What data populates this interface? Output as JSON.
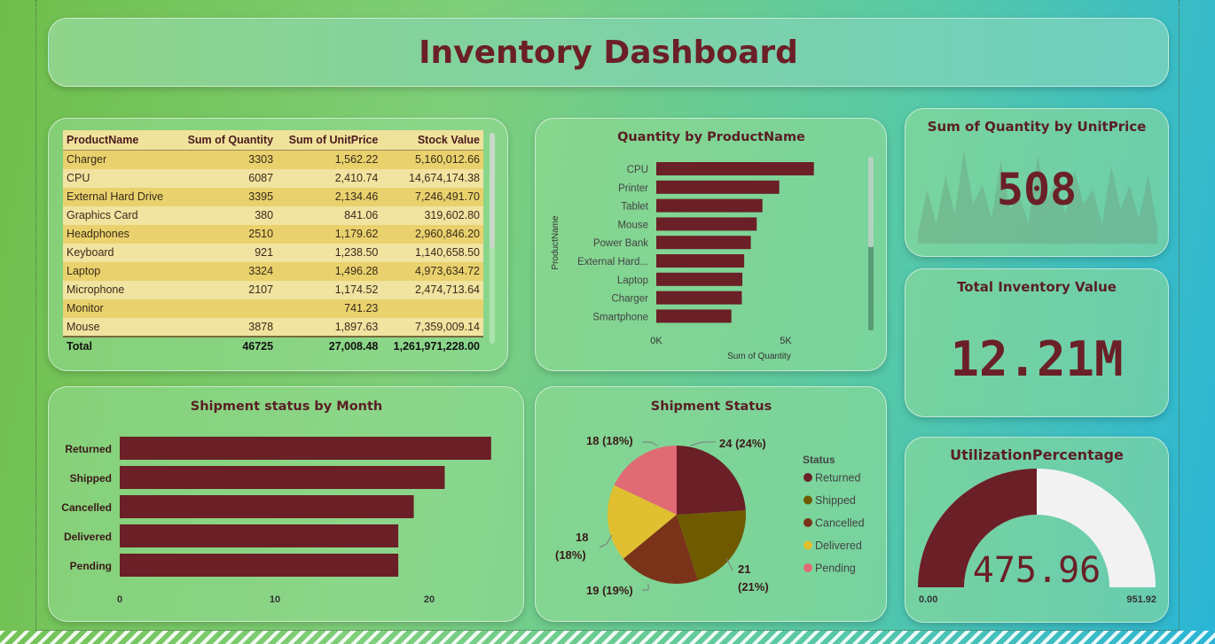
{
  "title": "Inventory Dashboard",
  "table": {
    "headers": [
      "ProductName",
      "Sum of Quantity",
      "Sum of UnitPrice",
      "Stock Value"
    ],
    "rows": [
      [
        "Charger",
        "3303",
        "1,562.22",
        "5,160,012.66"
      ],
      [
        "CPU",
        "6087",
        "2,410.74",
        "14,674,174.38"
      ],
      [
        "External Hard Drive",
        "3395",
        "2,134.46",
        "7,246,491.70"
      ],
      [
        "Graphics Card",
        "380",
        "841.06",
        "319,602.80"
      ],
      [
        "Headphones",
        "2510",
        "1,179.62",
        "2,960,846.20"
      ],
      [
        "Keyboard",
        "921",
        "1,238.50",
        "1,140,658.50"
      ],
      [
        "Laptop",
        "3324",
        "1,496.28",
        "4,973,634.72"
      ],
      [
        "Microphone",
        "2107",
        "1,174.52",
        "2,474,713.64"
      ],
      [
        "Monitor",
        "",
        "741.23",
        ""
      ],
      [
        "Mouse",
        "3878",
        "1,897.63",
        "7,359,009.14"
      ]
    ],
    "total": [
      "Total",
      "46725",
      "27,008.48",
      "1,261,971,228.00"
    ]
  },
  "qty_chart": {
    "title": "Quantity by ProductName",
    "ylabel": "ProductName",
    "xlabel": "Sum of Quantity",
    "tick_labels": [
      "0K",
      "5K"
    ],
    "bar_color": "#6b1f26"
  },
  "kpi_unitprice": {
    "title": "Sum of Quantity by UnitPrice",
    "value": "508"
  },
  "kpi_inventory": {
    "title": "Total Inventory Value",
    "value": "12.21M"
  },
  "kpi_util": {
    "title": "UtilizationPercentage",
    "value": "475.96",
    "min": "0.00",
    "max": "951.92",
    "fraction": 0.5
  },
  "ship_month": {
    "title": "Shipment status by Month",
    "tick_labels": [
      "0",
      "10",
      "20"
    ],
    "bar_color": "#6b1f26"
  },
  "ship_status": {
    "title": "Shipment Status",
    "legend_title": "Status",
    "slice_labels": [
      "24 (24%)",
      "21",
      "(21%)",
      "19 (19%)",
      "18",
      "(18%)",
      "18 (18%)"
    ]
  },
  "chart_data": [
    {
      "type": "bar",
      "title": "Quantity by ProductName",
      "xlabel": "Sum of Quantity",
      "ylabel": "ProductName",
      "categories": [
        "CPU",
        "Printer",
        "Tablet",
        "Mouse",
        "Power Bank",
        "External Hard...",
        "Laptop",
        "Charger",
        "Smartphone"
      ],
      "values": [
        6087,
        4750,
        4100,
        3878,
        3650,
        3395,
        3324,
        3303,
        2900
      ],
      "xlim": [
        0,
        8000
      ]
    },
    {
      "type": "bar",
      "title": "Shipment status by Month",
      "categories": [
        "Returned",
        "Shipped",
        "Cancelled",
        "Delivered",
        "Pending"
      ],
      "values": [
        24,
        21,
        19,
        18,
        18
      ],
      "xlim": [
        0,
        25
      ]
    },
    {
      "type": "pie",
      "title": "Shipment Status",
      "categories": [
        "Returned",
        "Shipped",
        "Cancelled",
        "Delivered",
        "Pending"
      ],
      "values": [
        24,
        21,
        19,
        18,
        18
      ],
      "colors": [
        "#6b1f26",
        "#6f5a00",
        "#7a3318",
        "#e0c030",
        "#e06b74"
      ]
    },
    {
      "type": "area",
      "title": "Sum of Quantity by UnitPrice",
      "values": [
        10,
        55,
        20,
        70,
        30,
        95,
        40,
        60,
        25,
        85,
        35,
        50,
        20,
        90,
        45,
        65,
        30,
        75,
        40,
        55,
        20,
        80,
        35,
        60,
        25,
        70,
        15
      ]
    }
  ]
}
